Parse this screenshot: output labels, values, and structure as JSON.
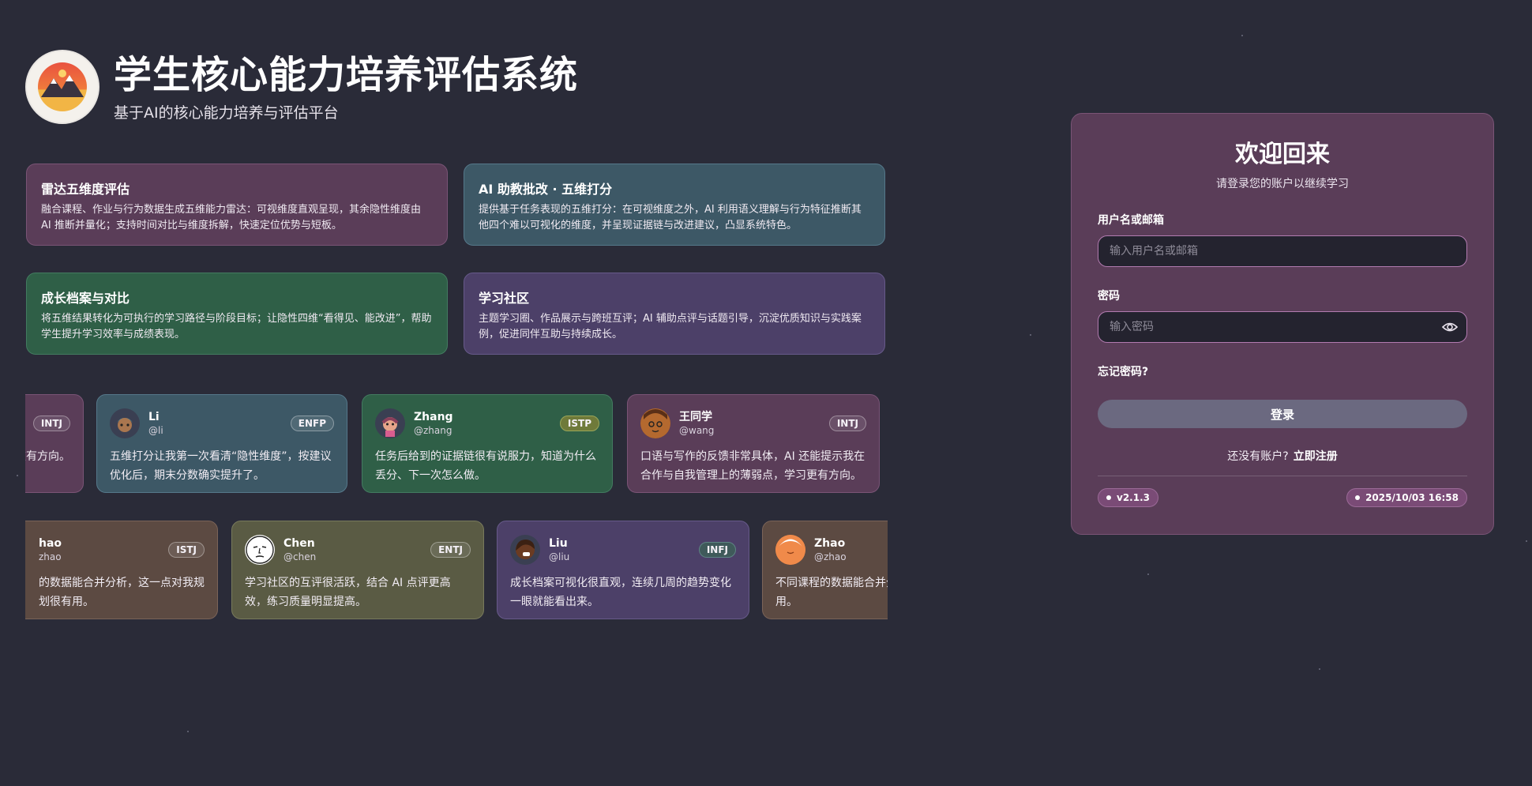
{
  "header": {
    "title": "学生核心能力培养评估系统",
    "subtitle": "基于AI的核心能力培养与评估平台"
  },
  "features": [
    {
      "title": "雷达五维度评估",
      "desc": "融合课程、作业与行为数据生成五维能力雷达：可视维度直观呈现，其余隐性维度由 AI 推断并量化；支持时间对比与维度拆解，快速定位优势与短板。"
    },
    {
      "title": "AI 助教批改 · 五维打分",
      "desc": "提供基于任务表现的五维打分：在可视维度之外，AI 利用语义理解与行为特征推断其他四个难以可视化的维度，并呈现证据链与改进建议，凸显系统特色。"
    },
    {
      "title": "成长档案与对比",
      "desc": "将五维结果转化为可执行的学习路径与阶段目标；让隐性四维“看得见、能改进”，帮助学生提升学习效率与成绩表现。"
    },
    {
      "title": "学习社区",
      "desc": "主题学习圈、作品展示与跨班互评；AI 辅助点评与话题引导，沉淀优质知识与实践案例，促进同伴互助与持续成长。"
    }
  ],
  "reviews_row1": [
    {
      "name": "",
      "handle": "",
      "mbti": "INTJ",
      "text": "提示我在有方向。"
    },
    {
      "name": "Li",
      "handle": "@li",
      "mbti": "ENFP",
      "text": "五维打分让我第一次看清“隐性维度”，按建议优化后，期末分数确实提升了。"
    },
    {
      "name": "Zhang",
      "handle": "@zhang",
      "mbti": "ISTP",
      "text": "任务后给到的证据链很有说服力，知道为什么丢分、下一次怎么做。"
    },
    {
      "name": "王同学",
      "handle": "@wang",
      "mbti": "INTJ",
      "text": "口语与写作的反馈非常具体，AI 还能提示我在合作与自我管理上的薄弱点，学习更有方向。"
    }
  ],
  "reviews_row2": [
    {
      "name": "hao",
      "handle": "zhao",
      "mbti": "ISTJ",
      "text": "的数据能合并分析，这一点对我规划很有用。"
    },
    {
      "name": "Chen",
      "handle": "@chen",
      "mbti": "ENTJ",
      "text": "学习社区的互评很活跃，结合 AI 点评更高效，练习质量明显提高。"
    },
    {
      "name": "Liu",
      "handle": "@liu",
      "mbti": "INFJ",
      "text": "成长档案可视化很直观，连续几周的趋势变化一眼就能看出来。"
    },
    {
      "name": "Zhao",
      "handle": "@zhao",
      "mbti": "",
      "text": "不同课程的数据能合并分析，学习节奏很有用。"
    }
  ],
  "login": {
    "title": "欢迎回来",
    "subtitle": "请登录您的账户以继续学习",
    "username_label": "用户名或邮箱",
    "username_placeholder": "输入用户名或邮箱",
    "password_label": "密码",
    "password_placeholder": "输入密码",
    "forgot": "忘记密码?",
    "submit": "登录",
    "no_account": "还没有账户?",
    "register": "立即注册",
    "version": "v2.1.3",
    "datetime": "2025/10/03 16:58"
  },
  "colors": {
    "background": "#2a2b38",
    "card_purple": "#5a3d58",
    "card_teal": "#3d5866",
    "card_green": "#2f5f47",
    "card_violet": "#4c4068",
    "card_brown": "#5c4a42",
    "card_olive": "#5a5b44",
    "button": "#6b6980"
  }
}
